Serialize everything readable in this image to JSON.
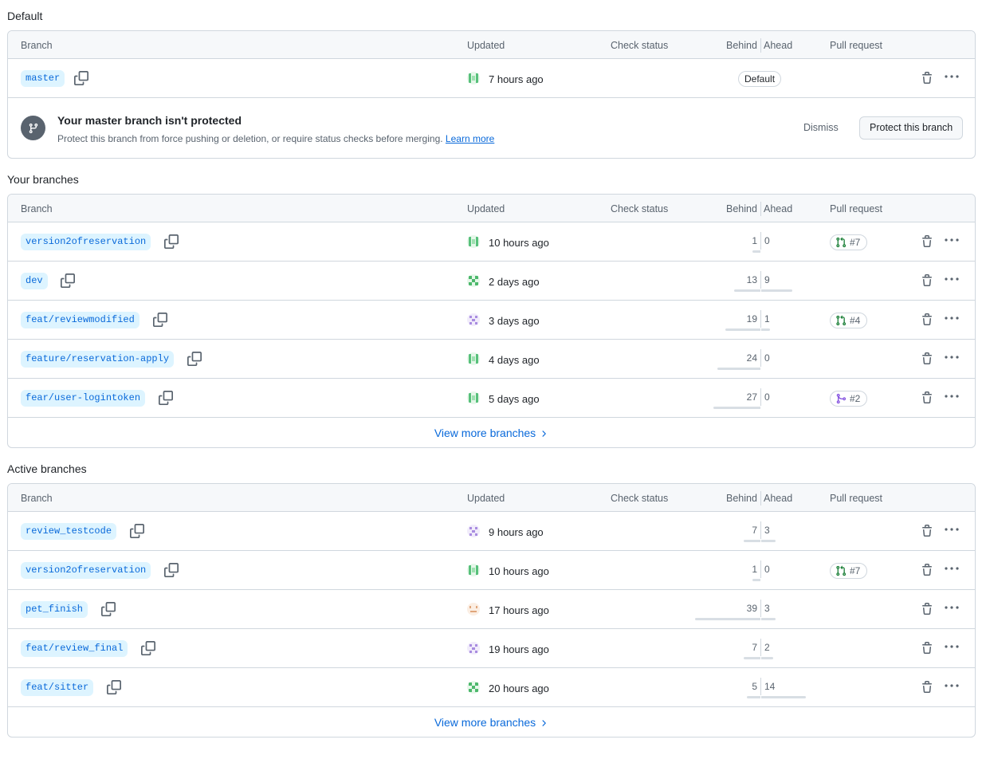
{
  "headers": {
    "branch": "Branch",
    "updated": "Updated",
    "check_status": "Check status",
    "behind": "Behind",
    "ahead": "Ahead",
    "pull_request": "Pull request"
  },
  "default_section": {
    "title": "Default",
    "row": {
      "name": "master",
      "updated": "7 hours ago",
      "badge": "Default",
      "avatar": "green-stripes"
    },
    "protection": {
      "title": "Your master branch isn't protected",
      "text": "Protect this branch from force pushing or deletion, or require status checks before merging.",
      "learn_more": "Learn more",
      "dismiss": "Dismiss",
      "protect": "Protect this branch"
    }
  },
  "your_section": {
    "title": "Your branches",
    "rows": [
      {
        "name": "version2ofreservation",
        "updated": "10 hours ago",
        "behind": "1",
        "ahead": "0",
        "pr": "#7",
        "pr_type": "open",
        "avatar": "green-stripes"
      },
      {
        "name": "dev",
        "updated": "2 days ago",
        "behind": "13",
        "ahead": "9",
        "pr": "",
        "avatar": "green-checks"
      },
      {
        "name": "feat/reviewmodified",
        "updated": "3 days ago",
        "behind": "19",
        "ahead": "1",
        "pr": "#4",
        "pr_type": "open",
        "avatar": "purple-dots"
      },
      {
        "name": "feature/reservation-apply",
        "updated": "4 days ago",
        "behind": "24",
        "ahead": "0",
        "pr": "",
        "avatar": "green-stripes"
      },
      {
        "name": "fear/user-logintoken",
        "updated": "5 days ago",
        "behind": "27",
        "ahead": "0",
        "pr": "#2",
        "pr_type": "merged",
        "avatar": "green-stripes"
      }
    ],
    "more": "View more branches"
  },
  "active_section": {
    "title": "Active branches",
    "rows": [
      {
        "name": "review_testcode",
        "updated": "9 hours ago",
        "behind": "7",
        "ahead": "3",
        "pr": "",
        "avatar": "purple-dots"
      },
      {
        "name": "version2ofreservation",
        "updated": "10 hours ago",
        "behind": "1",
        "ahead": "0",
        "pr": "#7",
        "pr_type": "open",
        "avatar": "green-stripes"
      },
      {
        "name": "pet_finish",
        "updated": "17 hours ago",
        "behind": "39",
        "ahead": "3",
        "pr": "",
        "avatar": "orange-face"
      },
      {
        "name": "feat/review_final",
        "updated": "19 hours ago",
        "behind": "7",
        "ahead": "2",
        "pr": "",
        "avatar": "purple-dots"
      },
      {
        "name": "feat/sitter",
        "updated": "20 hours ago",
        "behind": "5",
        "ahead": "14",
        "pr": "",
        "avatar": "green-checks"
      }
    ],
    "more": "View more branches"
  },
  "colors": {
    "accent": "#0969da",
    "pr_open": "#1a7f37",
    "pr_merged": "#8250df",
    "border": "#d0d7de"
  }
}
